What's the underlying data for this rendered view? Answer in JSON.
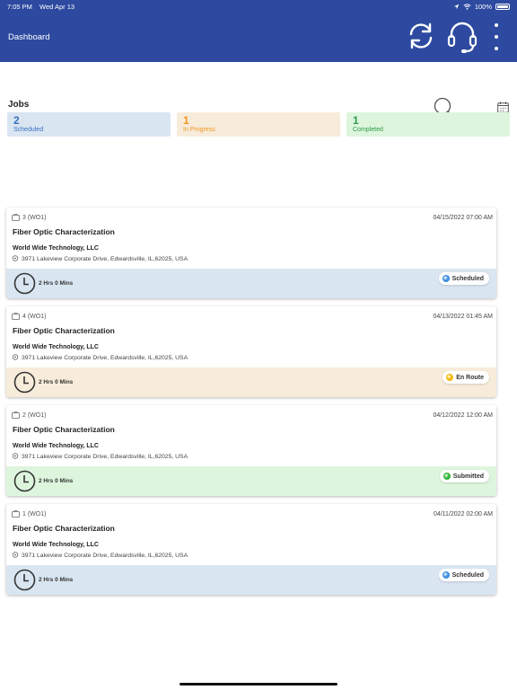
{
  "status_bar": {
    "time": "7:05 PM",
    "date": "Wed Apr 13",
    "battery": "100%"
  },
  "header": {
    "title": "Dashboard",
    "icons": [
      "sync-icon",
      "headset-icon",
      "more-vertical-icon"
    ]
  },
  "jobs": {
    "title": "Jobs"
  },
  "summary": [
    {
      "count": "2",
      "label": "Scheduled"
    },
    {
      "count": "1",
      "label": "In Progress"
    },
    {
      "count": "1",
      "label": "Completed"
    }
  ],
  "cards": [
    {
      "wo": "3 (WO1)",
      "date": "04/15/2022 07:00 AM",
      "title": "Fiber Optic Characterization",
      "company": "World Wide Technology, LLC",
      "address": "3971 Lakeview Corporate Drive, Edwardsville, IL,62025, USA",
      "duration": "2 Hrs 0 Mins",
      "status": "Scheduled",
      "footer_color": "#dae5f2",
      "dot_color": "#3b8de0"
    },
    {
      "wo": "4 (WO1)",
      "date": "04/13/2022 01:45 AM",
      "title": "Fiber Optic Characterization",
      "company": "World Wide Technology, LLC",
      "address": "3971 Lakeview Corporate Drive, Edwardsville, IL,62025, USA",
      "duration": "2 Hrs 0 Mins",
      "status": "En Route",
      "footer_color": "#f7ebda",
      "dot_color": "#f2b705"
    },
    {
      "wo": "2 (WO1)",
      "date": "04/12/2022 12:00 AM",
      "title": "Fiber Optic Characterization",
      "company": "World Wide Technology, LLC",
      "address": "3971 Lakeview Corporate Drive, Edwardsville, IL,62025, USA",
      "duration": "2 Hrs 0 Mins",
      "status": "Submitted",
      "footer_color": "#ddf5dd",
      "dot_color": "#2fb536"
    },
    {
      "wo": "1 (WO1)",
      "date": "04/11/2022 02:00 AM",
      "title": "Fiber Optic Characterization",
      "company": "World Wide Technology, LLC",
      "address": "3971 Lakeview Corporate Drive, Edwardsville, IL,62025, USA",
      "duration": "2 Hrs 0 Mins",
      "status": "Scheduled",
      "footer_color": "#dae5f2",
      "dot_color": "#3b8de0"
    }
  ]
}
